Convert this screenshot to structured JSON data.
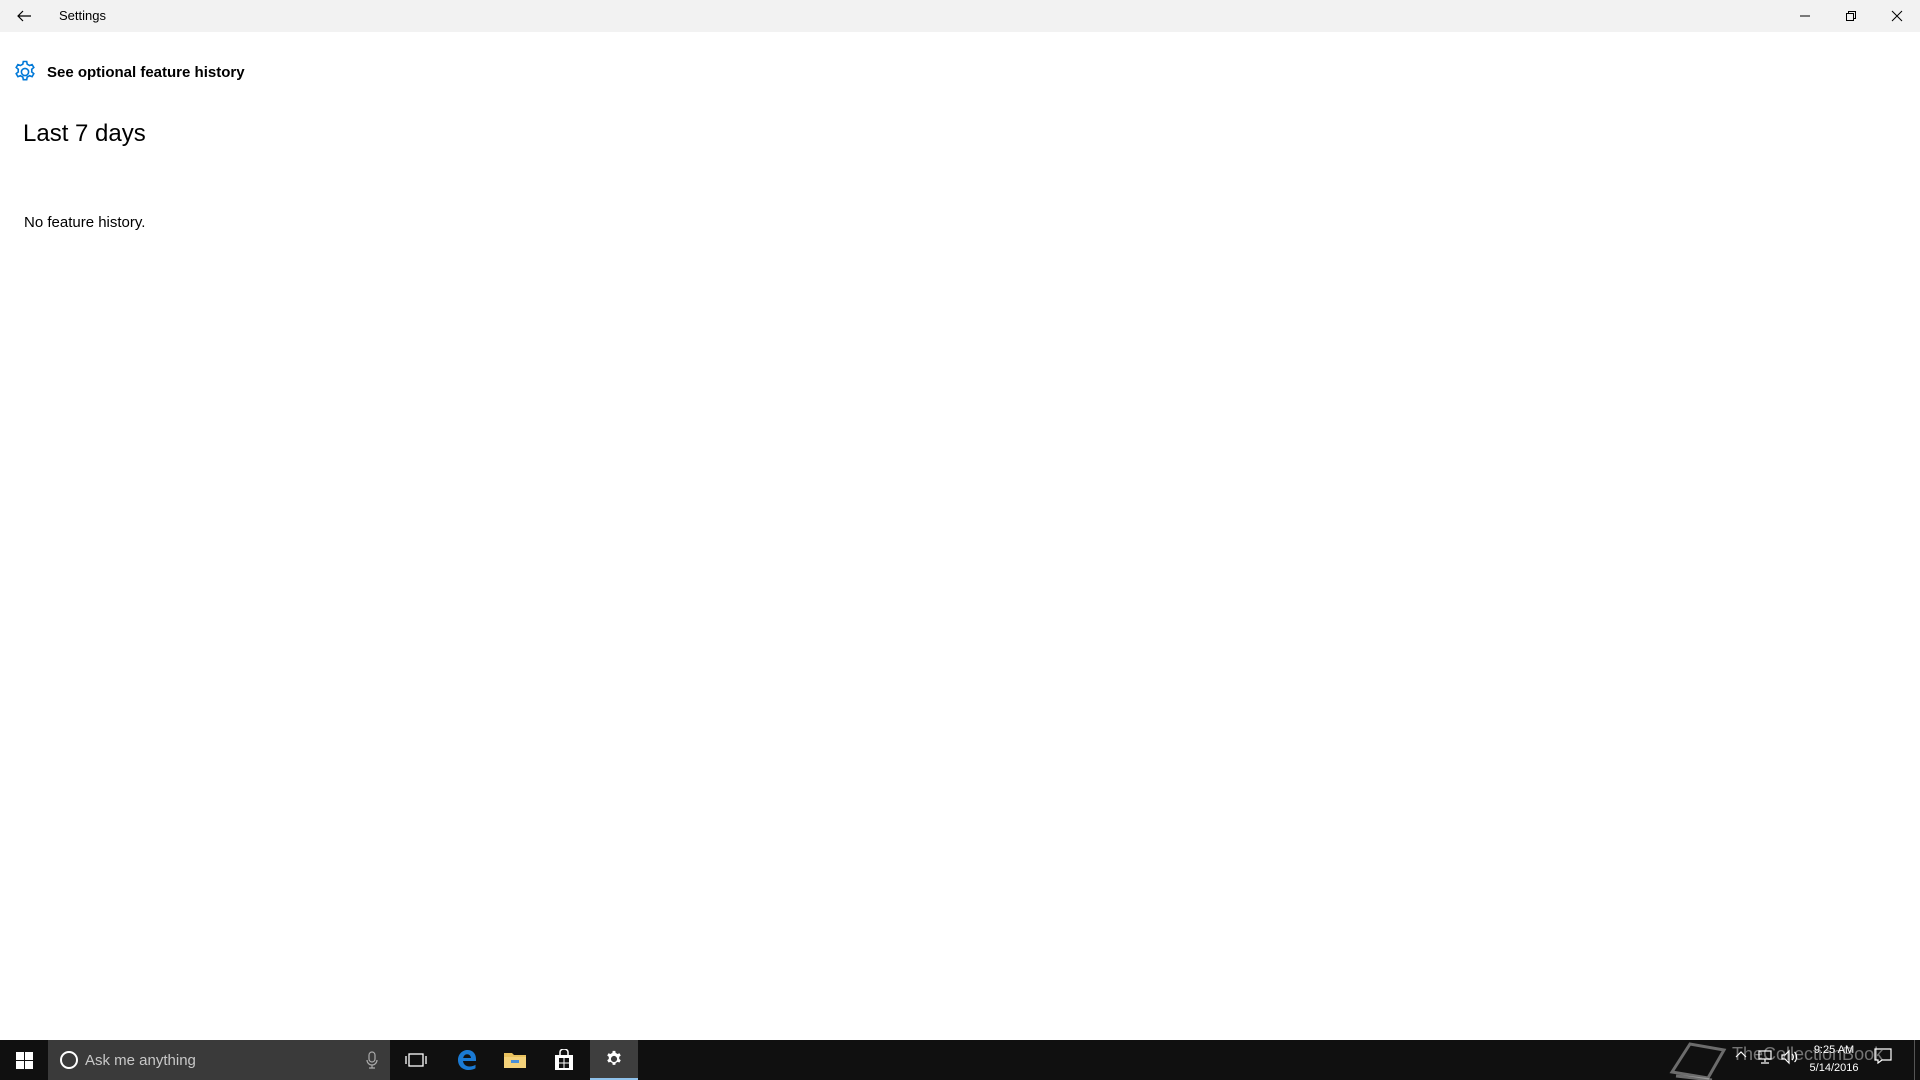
{
  "window": {
    "title": "Settings"
  },
  "page": {
    "title": "See optional feature history",
    "section_heading": "Last 7 days",
    "empty_message": "No feature history."
  },
  "taskbar": {
    "search_placeholder": "Ask me anything",
    "clock": {
      "time": "9:25 AM",
      "date": "5/14/2016"
    },
    "watermark": "TheCollectionBook"
  },
  "colors": {
    "accent": "#0078d7",
    "titlebar_bg": "#f2f2f2",
    "taskbar_bg": "#101010",
    "search_bg": "#3a3a3a",
    "active_indicator": "#8fc1ea"
  }
}
